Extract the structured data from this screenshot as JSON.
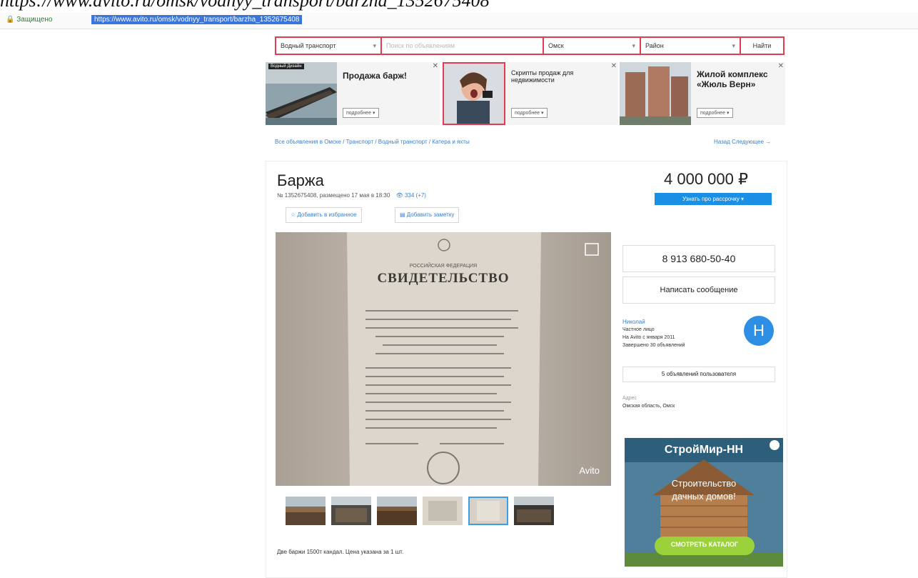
{
  "caption_url": "https://www.avito.ru/omsk/vodnyy_transport/barzha_1352675408",
  "browser": {
    "secure_label": "Защищено",
    "url": "https://www.avito.ru/omsk/vodnyy_transport/barzha_1352675408"
  },
  "search": {
    "category": "Водный транспорт",
    "query_placeholder": "Поиск по объявлениям",
    "city": "Омск",
    "district": "Район",
    "button": "Найти"
  },
  "ads": [
    {
      "badge": "Водный Дизайн",
      "title": "Продажа барж!",
      "button": "подробнее ▾"
    },
    {
      "title": "Скрипты продаж для недвижимости",
      "button": "подробнее ▾"
    },
    {
      "title": "Жилой комплекс «Жюль Верн»",
      "button": "подробнее ▾"
    }
  ],
  "breadcrumbs": "Все объявления в Омске / Транспорт / Водный транспорт / Катера и яхты",
  "breadcrumbs_right": "Назад  Следующее →",
  "listing": {
    "title": "Баржа",
    "meta": "№ 1352675408, размещено 17 мая в 18:30",
    "views": "334 (+7)",
    "price": "4 000 000 ₽",
    "price_button": "Узнать про рассрочку ▾",
    "favorite": "Добавить в избранное",
    "note": "Добавить заметку",
    "photo_watermark": "Avito",
    "photo_doc_title": "СВИДЕТЕЛЬСТВО",
    "photo_doc_header": "РОССИЙСКАЯ ФЕДЕРАЦИЯ",
    "description": "Две баржи 1500т кандал. Цена указана за 1 шт."
  },
  "seller": {
    "phone": "8 913 680-50-40",
    "message": "Написать сообщение",
    "name": "Николай",
    "type": "Частное лицо",
    "since": "На Avito с января 2011",
    "completed": "Завершено 30 объявлений",
    "avatar_letter": "Н",
    "all_ads": "5 объявлений пользователя",
    "address_label": "Адрес",
    "address": "Омская область, Омск"
  },
  "banner": {
    "brand": "СтройМир-НН",
    "text1": "Строительство",
    "text2": "дачных домов!",
    "button": "СМОТРЕТЬ КАТАЛОГ"
  },
  "colors": {
    "highlight": "#e33c50",
    "link": "#3d7fc9",
    "primary": "#1a8fe3"
  }
}
